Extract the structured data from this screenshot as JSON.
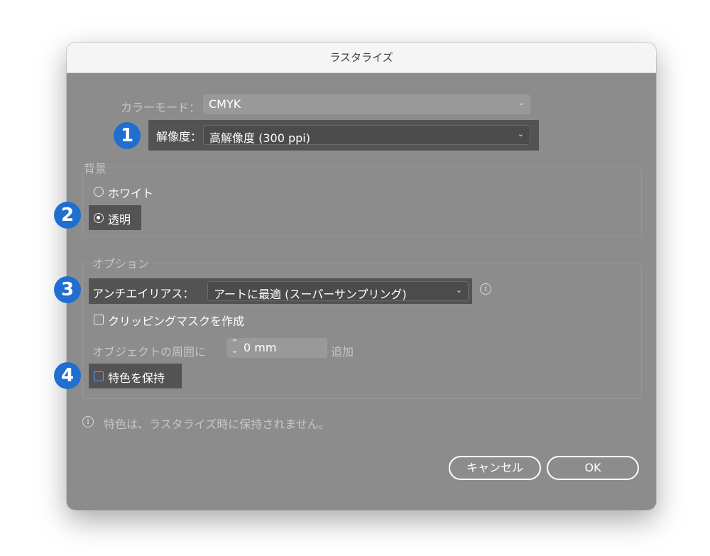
{
  "dialog": {
    "title": "ラスタライズ",
    "color_mode": {
      "label": "カラーモード：",
      "value": "CMYK"
    },
    "resolution": {
      "label": "解像度：",
      "value": "高解像度 (300 ppi)"
    },
    "background": {
      "heading": "背景",
      "options": [
        {
          "label": "ホワイト",
          "selected": false
        },
        {
          "label": "透明",
          "selected": true
        }
      ]
    },
    "options": {
      "heading": "オプション",
      "antialias": {
        "label": "アンチエイリアス：",
        "value": "アートに最適 (スーパーサンプリング)"
      },
      "clipping_mask": {
        "label": "クリッピングマスクを作成",
        "checked": false
      },
      "padding": {
        "label": "オブジェクトの周囲に",
        "value": "0 mm",
        "suffix": "追加"
      },
      "spot_color": {
        "label": "特色を保持",
        "checked": false
      }
    },
    "info_message": "特色は、ラスタライズ時に保持されません。",
    "buttons": {
      "cancel": "キャンセル",
      "ok": "OK"
    }
  },
  "markers": [
    "1",
    "2",
    "3",
    "4"
  ],
  "icons": {
    "chevron": "chevron-down-icon",
    "info": "info-icon",
    "stepper": "stepper-icon"
  },
  "colors": {
    "marker": "#1f6fd1",
    "dialog_bg": "#8c8c8c",
    "highlight": "#535353"
  }
}
